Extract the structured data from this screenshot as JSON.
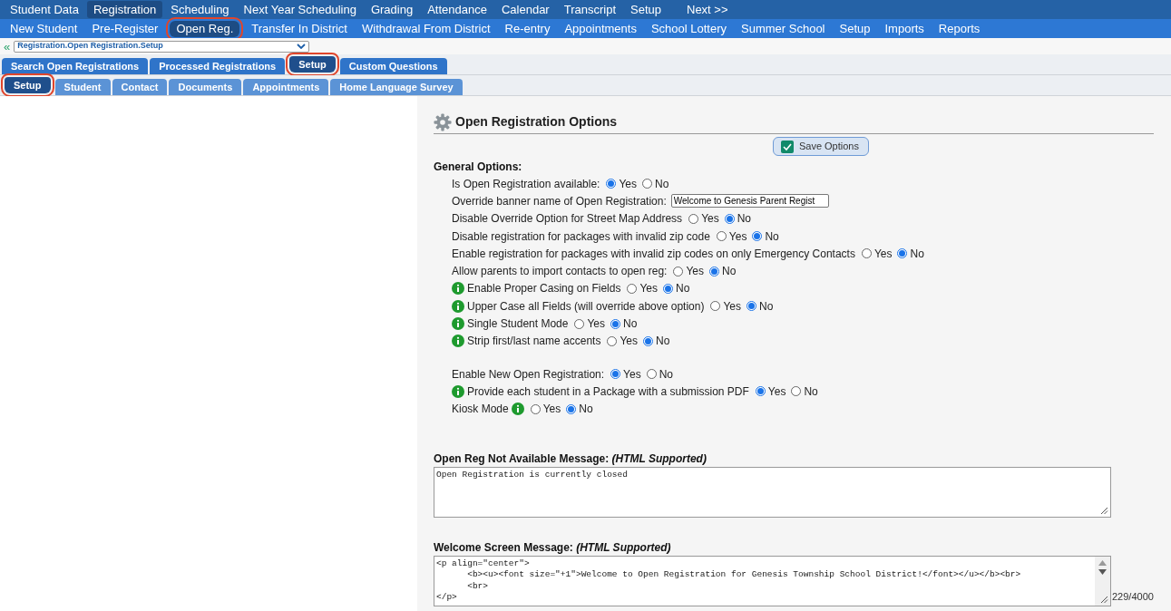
{
  "main_menu": [
    {
      "label": "Student Data",
      "selected": false
    },
    {
      "label": "Registration",
      "selected": true
    },
    {
      "label": "Scheduling",
      "selected": false
    },
    {
      "label": "Next Year Scheduling",
      "selected": false
    },
    {
      "label": "Grading",
      "selected": false
    },
    {
      "label": "Attendance",
      "selected": false
    },
    {
      "label": "Calendar",
      "selected": false
    },
    {
      "label": "Transcript",
      "selected": false
    },
    {
      "label": "Setup",
      "selected": false
    },
    {
      "label": "Next >>",
      "selected": false
    }
  ],
  "sub_menu": [
    {
      "label": "New Student",
      "selected": false,
      "highlighted": false
    },
    {
      "label": "Pre-Register",
      "selected": false,
      "highlighted": false
    },
    {
      "label": "Open Reg.",
      "selected": true,
      "highlighted": true
    },
    {
      "label": "Transfer In District",
      "selected": false,
      "highlighted": false
    },
    {
      "label": "Withdrawal From District",
      "selected": false,
      "highlighted": false
    },
    {
      "label": "Re-entry",
      "selected": false,
      "highlighted": false
    },
    {
      "label": "Appointments",
      "selected": false,
      "highlighted": false
    },
    {
      "label": "School Lottery",
      "selected": false,
      "highlighted": false
    },
    {
      "label": "Summer School",
      "selected": false,
      "highlighted": false
    },
    {
      "label": "Setup",
      "selected": false,
      "highlighted": false
    },
    {
      "label": "Imports",
      "selected": false,
      "highlighted": false
    },
    {
      "label": "Reports",
      "selected": false,
      "highlighted": false
    }
  ],
  "breadcrumb": {
    "collapse": "«",
    "value": "Registration.Open Registration.Setup"
  },
  "tabs": [
    {
      "label": "Search Open Registrations",
      "selected": false,
      "highlighted": false
    },
    {
      "label": "Processed Registrations",
      "selected": false,
      "highlighted": false
    },
    {
      "label": "Setup",
      "selected": true,
      "highlighted": true
    },
    {
      "label": "Custom Questions",
      "selected": false,
      "highlighted": false
    }
  ],
  "subtabs": [
    {
      "label": "Setup",
      "selected": true,
      "highlighted": true
    },
    {
      "label": "Student",
      "selected": false,
      "highlighted": false
    },
    {
      "label": "Contact",
      "selected": false,
      "highlighted": false
    },
    {
      "label": "Documents",
      "selected": false,
      "highlighted": false
    },
    {
      "label": "Appointments",
      "selected": false,
      "highlighted": false
    },
    {
      "label": "Home Language Survey",
      "selected": false,
      "highlighted": false
    }
  ],
  "panel": {
    "title": "Open Registration Options",
    "save_button": "Save Options",
    "section": "General Options:",
    "options": [
      {
        "kind": "radio",
        "label": "Is Open Registration available:",
        "choices": [
          {
            "label": "Yes",
            "selected": true
          },
          {
            "label": "No",
            "selected": false
          }
        ]
      },
      {
        "kind": "text",
        "label": "Override banner name of Open Registration:",
        "value": "Welcome to Genesis Parent Regist"
      },
      {
        "kind": "radio",
        "label": "Disable Override Option for Street Map Address",
        "choices": [
          {
            "label": "Yes",
            "selected": false
          },
          {
            "label": "No",
            "selected": true
          }
        ]
      },
      {
        "kind": "radio",
        "label": "Disable registration for packages with invalid zip code",
        "choices": [
          {
            "label": "Yes",
            "selected": false
          },
          {
            "label": "No",
            "selected": true
          }
        ]
      },
      {
        "kind": "radio",
        "label": "Enable registration for packages with invalid zip codes on only Emergency Contacts",
        "choices": [
          {
            "label": "Yes",
            "selected": false
          },
          {
            "label": "No",
            "selected": true
          }
        ]
      },
      {
        "kind": "radio",
        "label": "Allow parents to import contacts to open reg:",
        "choices": [
          {
            "label": "Yes",
            "selected": false
          },
          {
            "label": "No",
            "selected": true
          }
        ]
      },
      {
        "kind": "radio",
        "info_before": true,
        "label": "Enable Proper Casing on Fields",
        "choices": [
          {
            "label": "Yes",
            "selected": false
          },
          {
            "label": "No",
            "selected": true
          }
        ]
      },
      {
        "kind": "radio",
        "info_before": true,
        "label": "Upper Case all Fields (will override above option)",
        "choices": [
          {
            "label": "Yes",
            "selected": false
          },
          {
            "label": "No",
            "selected": true
          }
        ]
      },
      {
        "kind": "radio",
        "info_before": true,
        "label": "Single Student Mode",
        "choices": [
          {
            "label": "Yes",
            "selected": false
          },
          {
            "label": "No",
            "selected": true
          }
        ]
      },
      {
        "kind": "radio",
        "info_before": true,
        "label": "Strip first/last name accents",
        "choices": [
          {
            "label": "Yes",
            "selected": false
          },
          {
            "label": "No",
            "selected": true
          }
        ]
      },
      {
        "kind": "radio",
        "gap_before": true,
        "label": "Enable New Open Registration:",
        "choices": [
          {
            "label": "Yes",
            "selected": true
          },
          {
            "label": "No",
            "selected": false
          }
        ]
      },
      {
        "kind": "radio",
        "info_before": true,
        "label": "Provide each student in a Package with a submission PDF",
        "choices": [
          {
            "label": "Yes",
            "selected": true
          },
          {
            "label": "No",
            "selected": false
          }
        ]
      },
      {
        "kind": "radio",
        "info_after": true,
        "label": "Kiosk Mode",
        "choices": [
          {
            "label": "Yes",
            "selected": false
          },
          {
            "label": "No",
            "selected": true
          }
        ]
      }
    ],
    "messages": [
      {
        "label": "Open Reg Not Available Message: *(HTML Supported)*",
        "value": "Open Registration is currently closed",
        "scrollbar": false
      },
      {
        "label": "Welcome Screen Message: *(HTML Supported)*",
        "value": "<p align=\"center\">\n      <b><u><font size=\"+1\">Welcome to Open Registration for Genesis Township School District!</font></u></b><br>\n      <br>\n</p>",
        "scrollbar": true,
        "counter": "229/4000"
      }
    ]
  }
}
